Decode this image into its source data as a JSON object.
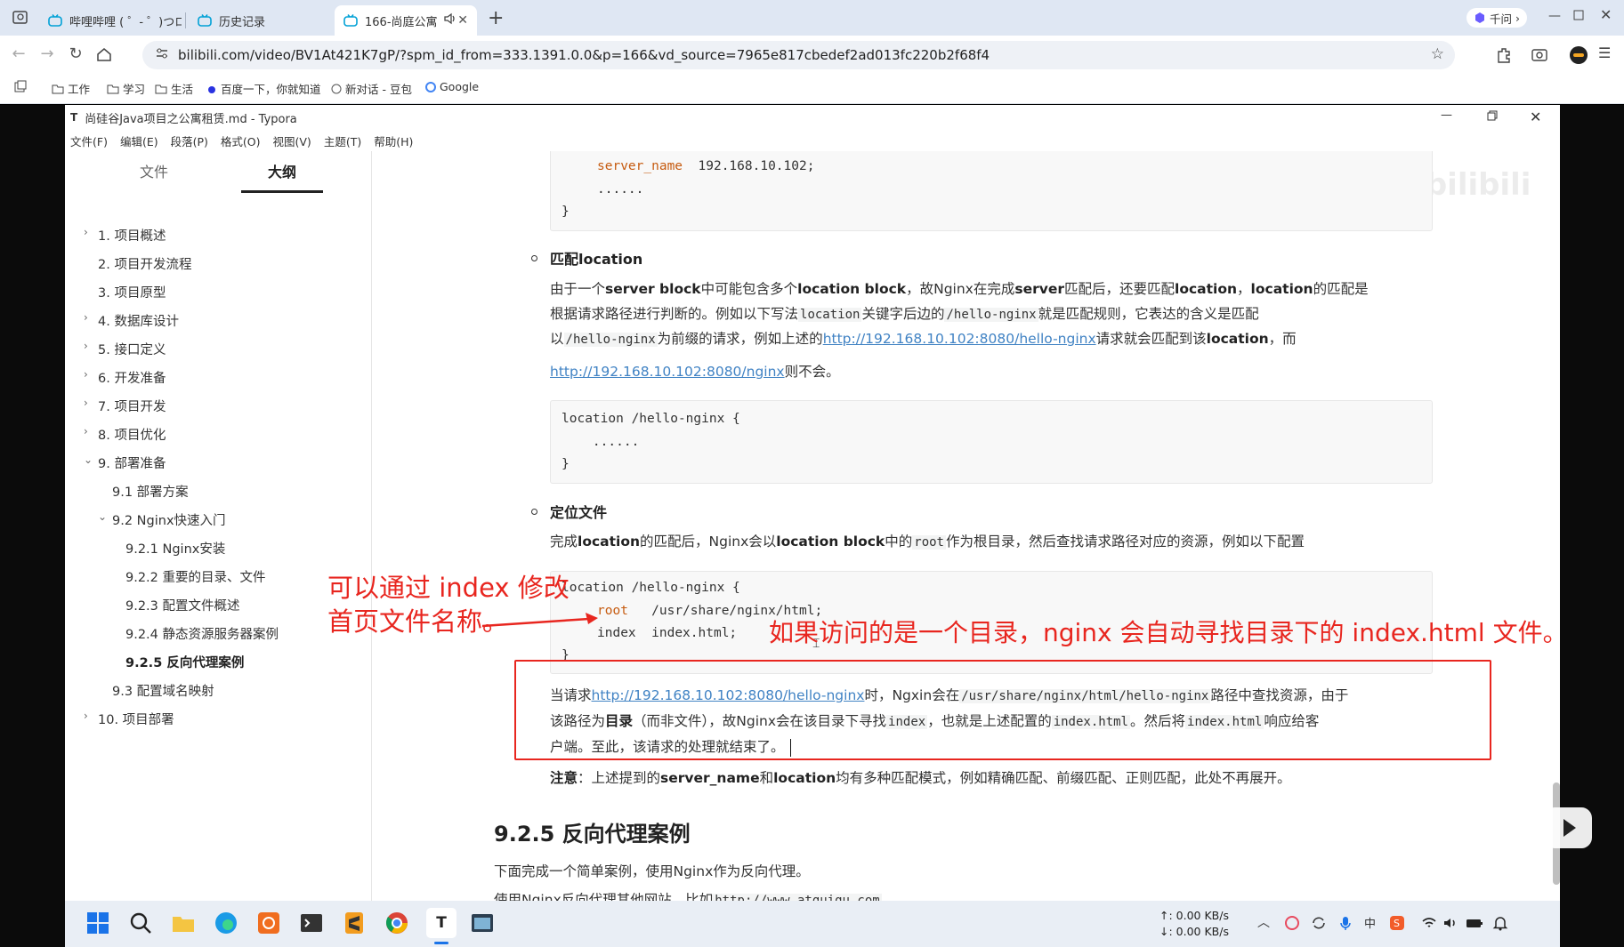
{
  "browser": {
    "tabs": [
      {
        "title": "哔哩哔哩 ( ゜- ゜)つロ"
      },
      {
        "title": "历史记录"
      },
      {
        "title": "166-尚庭公寓"
      }
    ],
    "ai_label": "千问",
    "url": "bilibili.com/video/BV1At421K7gP/?spm_id_from=333.1391.0.0&p=166&vd_source=7965e817cbedef2ad013fc220b2f68f4",
    "bookmarks": [
      "工作",
      "学习",
      "生活",
      "百度一下，你就知道",
      "新对话 - 豆包",
      "Google"
    ]
  },
  "typora": {
    "title": "尚硅谷Java项目之公寓租赁.md - Typora",
    "menu": [
      "文件(F)",
      "编辑(E)",
      "段落(P)",
      "格式(O)",
      "视图(V)",
      "主题(T)",
      "帮助(H)"
    ],
    "sidebar_tabs": [
      "文件",
      "大纲"
    ],
    "outline": [
      {
        "label": "1. 项目概述"
      },
      {
        "label": "2. 项目开发流程"
      },
      {
        "label": "3. 项目原型"
      },
      {
        "label": "4. 数据库设计"
      },
      {
        "label": "5. 接口定义"
      },
      {
        "label": "6. 开发准备"
      },
      {
        "label": "7. 项目开发"
      },
      {
        "label": "8. 项目优化"
      },
      {
        "label": "9. 部署准备"
      },
      {
        "label": "9.1 部署方案"
      },
      {
        "label": "9.2 Nginx快速入门"
      },
      {
        "label": "9.2.1 Nginx安装"
      },
      {
        "label": "9.2.2 重要的目录、文件"
      },
      {
        "label": "9.2.3 配置文件概述"
      },
      {
        "label": "9.2.4 静态资源服务器案例"
      },
      {
        "label": "9.2.5 反向代理案例"
      },
      {
        "label": "9.3 配置域名映射"
      },
      {
        "label": "10. 项目部署"
      }
    ],
    "content": {
      "code1_line1_kw": "server_name",
      "code1_line1_val": "192.168.10.102;",
      "code1_line2": "......",
      "code1_line3": "}",
      "h_match_location": "匹配location",
      "p1_l1": {
        "t1": "由于一个",
        "b1": "server block",
        "t2": "中可能包含多个",
        "b2": "location block",
        "t3": "，故Nginx在完成",
        "b3": "server",
        "t4": "匹配后，还要匹配",
        "b4": "location",
        "t5": "，",
        "b5": "location",
        "t6": "的匹配是"
      },
      "p1_l2": {
        "t1": "根据请求路径进行判断的。例如以下写法",
        "c1": "location",
        "t2": "关键字后边的",
        "c2": "/hello-nginx",
        "t3": "就是匹配规则，它表达的含义是匹配"
      },
      "p1_l3": {
        "t1": "以",
        "c1": "/hello-nginx",
        "t2": "为前缀的请求，例如上述的",
        "a1": "http://192.168.10.102:8080/hello-nginx",
        "t3": "请求就会匹配到该",
        "b1": "location",
        "t4": "，而"
      },
      "p1_l4": {
        "a1": "http://192.168.10.102:8080/nginx",
        "t1": "则不会。"
      },
      "code2_l1": "location /hello-nginx {",
      "code2_l2": "    ......",
      "code2_l3": "}",
      "h_locate_file": "定位文件",
      "p2": {
        "t1": "完成",
        "b1": "location",
        "t2": "的匹配后，Nginx会以",
        "b2": "location block",
        "t3": "中的",
        "c1": "root",
        "t4": "作为根目录，然后查找请求路径对应的资源，例如以下配置"
      },
      "code3_l1": "location /hello-nginx {",
      "code3_l2_kw": "root",
      "code3_l2_val": "/usr/share/nginx/html;",
      "code3_l3_kw": "index",
      "code3_l3_val": "index.html;",
      "code3_l4": "}",
      "p3_l1": {
        "t1": "当请求",
        "a1": "http://192.168.10.102:8080/hello-nginx",
        "t2": "时，Ngxin会在",
        "c1": "/usr/share/nginx/html/hello-nginx",
        "t3": "路径中查找资源，由于"
      },
      "p3_l2": {
        "t1": "该路径为",
        "b1": "目录",
        "t2": "（而非文件），故Nginx会在该目录下寻找",
        "c1": "index",
        "t3": "，也就是上述配置的",
        "c2": "index.html",
        "t4": "。然后将",
        "c3": "index.html",
        "t5": "响应给客"
      },
      "p3_l3": "户端。至此，该请求的处理就结束了。",
      "note": {
        "b1": "注意",
        "t1": "：上述提到的",
        "b2": "server_name",
        "t2": "和",
        "b3": "location",
        "t3": "均有多种匹配模式，例如精确匹配、前缀匹配、正则匹配，此处不再展开。"
      },
      "h3_proxy": "9.2.5 反向代理案例",
      "p4": "下面完成一个简单案例，使用Nginx作为反向代理。",
      "p5_t1": "使用Nginx反向代理其他网站，比如",
      "p5_c1": "http://www.atguigu.com"
    }
  },
  "annotations": {
    "left_l1": "可以通过 index 修改",
    "left_l2": "首页文件名称。",
    "right": "如果访问的是一个目录，nginx 会自动寻找目录下的 index.html 文件。"
  },
  "watermark": "尚硅谷 bilibili",
  "taskbar": {
    "net_up": "↑: 0.00 KB/s",
    "net_down": "↓: 0.00 KB/s"
  },
  "colors": {
    "accent_red": "#e8261f",
    "link": "#4183c4",
    "code_kw": "#c65b10"
  }
}
